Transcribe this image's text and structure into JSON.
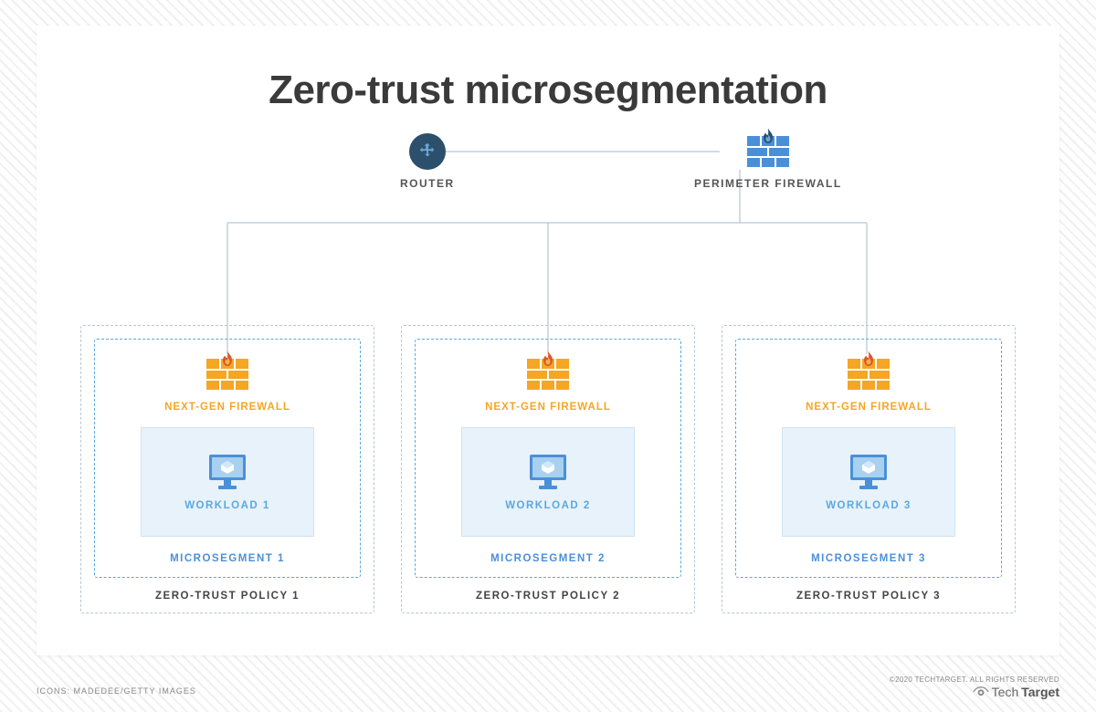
{
  "title": "Zero-trust microsegmentation",
  "top": {
    "router_label": "ROUTER",
    "perimeter_firewall_label": "PERIMETER FIREWALL"
  },
  "segments": [
    {
      "firewall_label": "NEXT-GEN FIREWALL",
      "workload_label": "WORKLOAD 1",
      "microsegment_label": "MICROSEGMENT 1",
      "policy_label": "ZERO-TRUST POLICY 1"
    },
    {
      "firewall_label": "NEXT-GEN FIREWALL",
      "workload_label": "WORKLOAD 2",
      "microsegment_label": "MICROSEGMENT 2",
      "policy_label": "ZERO-TRUST POLICY 2"
    },
    {
      "firewall_label": "NEXT-GEN FIREWALL",
      "workload_label": "WORKLOAD 3",
      "microsegment_label": "MICROSEGMENT 3",
      "policy_label": "ZERO-TRUST POLICY 3"
    }
  ],
  "footer": {
    "icons_credit": "ICONS: MADEDEE/GETTY IMAGES",
    "copyright": "©2020 TECHTARGET. ALL RIGHTS RESERVED",
    "brand_light": "Tech",
    "brand_bold": "Target"
  },
  "colors": {
    "orange": "#f5a623",
    "blue": "#4a90d9",
    "light_blue": "#5ba8e0",
    "dark_blue": "#2c4f6b"
  }
}
